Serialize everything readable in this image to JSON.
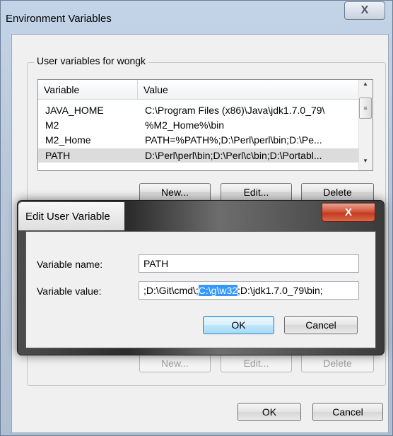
{
  "env_window": {
    "title": "Environment Variables",
    "close_label": "X",
    "group_label": "User variables for wongk",
    "columns": {
      "variable": "Variable",
      "value": "Value"
    },
    "rows": [
      {
        "variable": "JAVA_HOME",
        "value": "C:\\Program Files (x86)\\Java\\jdk1.7.0_79\\"
      },
      {
        "variable": "M2",
        "value": "%M2_Home%\\bin"
      },
      {
        "variable": "M2_Home",
        "value": "PATH=%PATH%;D:\\Perl\\perl\\bin;D:\\Pe..."
      },
      {
        "variable": "PATH",
        "value": "D:\\Perl\\perl\\bin;D:\\Perl\\c\\bin;D:\\Portabl..."
      }
    ],
    "selected_row": "PATH",
    "user_buttons": {
      "new": "New...",
      "edit": "Edit...",
      "delete": "Delete"
    },
    "system_buttons": {
      "new": "New...",
      "edit": "Edit...",
      "delete": "Delete"
    },
    "footer_buttons": {
      "ok": "OK",
      "cancel": "Cancel"
    }
  },
  "edit_dialog": {
    "title": "Edit User Variable",
    "close_label": "X",
    "name_label": "Variable name:",
    "name_value": "PATH",
    "value_label": "Variable value:",
    "value_before": ";D:\\Git\\cmd\\;",
    "value_selected": "C:\\g\\w32",
    "value_after": ";D:\\jdk1.7.0_79\\bin;",
    "ok": "OK",
    "cancel": "Cancel"
  },
  "colors": {
    "selection": "#3399ff",
    "close_red": "#c23b20",
    "default_button_border": "#3c7fb1"
  }
}
